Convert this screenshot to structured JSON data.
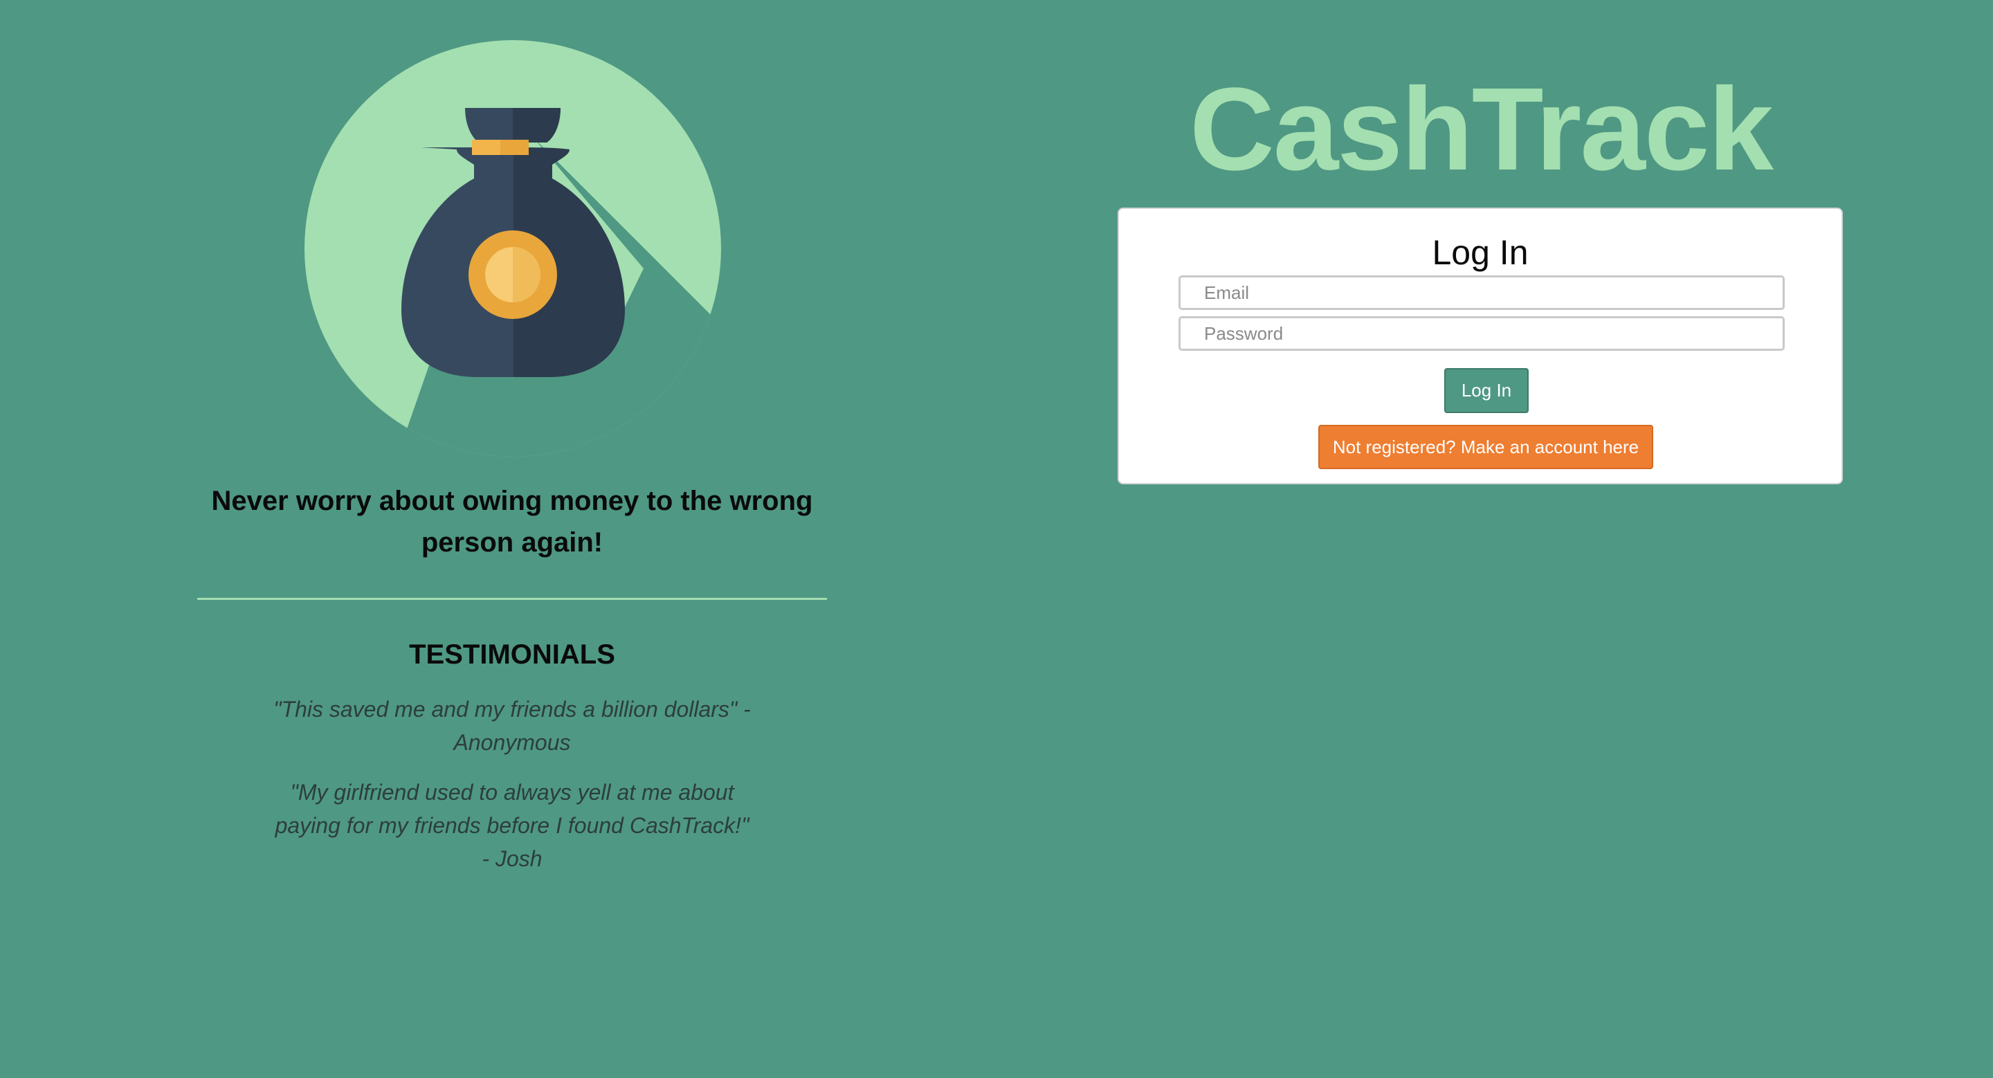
{
  "brand": {
    "title": "CashTrack",
    "accent_color": "#a3dfb0",
    "background_color": "#4f9884"
  },
  "hero": {
    "logo_icon": "money-bag-coin-icon",
    "tagline": "Never worry about owing money to the wrong person again!"
  },
  "testimonials": {
    "heading": "TESTIMONIALS",
    "items": [
      {
        "text": "\"This saved me and my friends a billion dollars\" - Anonymous"
      },
      {
        "text": "\"My girlfriend used to always yell at me about paying for my friends before I found CashTrack!\" - Josh"
      }
    ]
  },
  "login": {
    "heading": "Log In",
    "email_placeholder": "Email",
    "email_value": "",
    "password_placeholder": "Password",
    "password_value": "",
    "submit_label": "Log In",
    "submit_color": "#4f9884",
    "register_label": "Not registered? Make an account here",
    "register_color": "#ee7e31"
  }
}
